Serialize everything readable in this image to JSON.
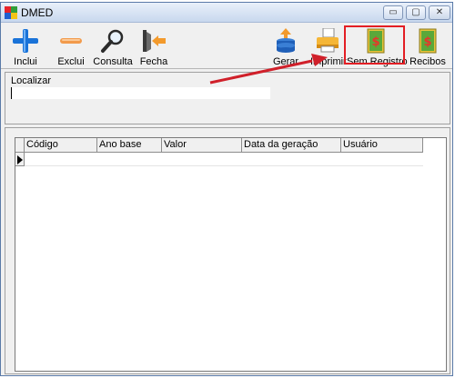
{
  "window": {
    "title": "DMED",
    "minimize_glyph": "▭",
    "maximize_glyph": "▢",
    "close_glyph": "✕"
  },
  "toolbar": {
    "inclui": "Inclui",
    "exclui": "Exclui",
    "consulta": "Consulta",
    "fecha": "Fecha",
    "gerar": "Gerar",
    "imprimir": "Imprimir",
    "sem_registro": "Sem Registro",
    "recibos": "Recibos"
  },
  "search": {
    "label": "Localizar",
    "value": ""
  },
  "grid": {
    "columns": [
      "Código",
      "Ano base",
      "Valor",
      "Data da geração",
      "Usuário"
    ]
  },
  "colors": {
    "highlight": "#e31e24",
    "arrow": "#d0202a"
  }
}
